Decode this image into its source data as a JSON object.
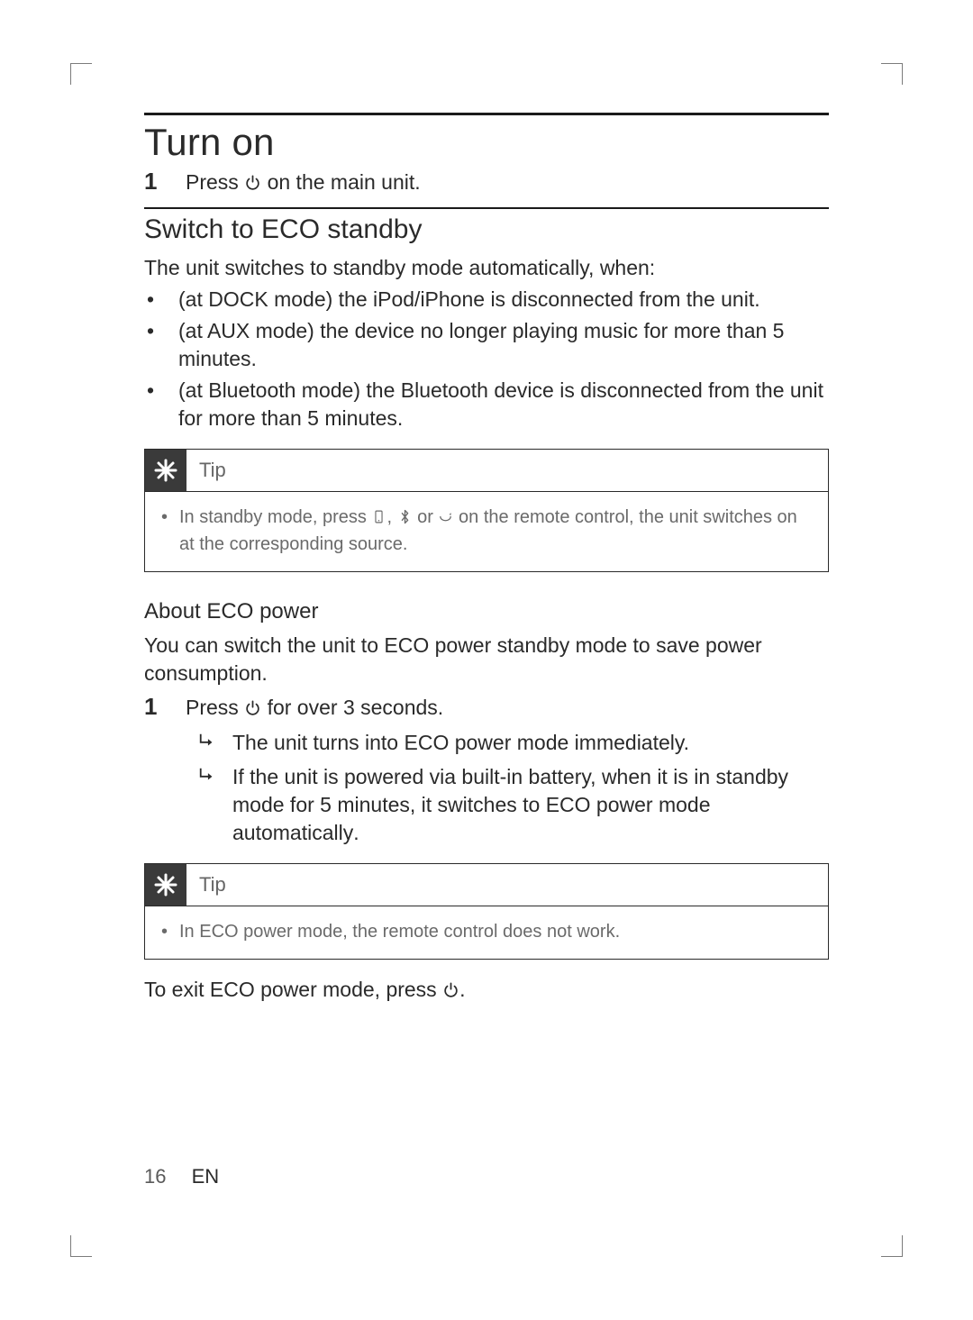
{
  "heading": "Turn on",
  "step1_num": "1",
  "step1_prefix": "Press ",
  "step1_suffix": " on the main unit.",
  "sub_heading": "Switch to ECO standby",
  "intro": "The unit switches to standby mode automatically, when:",
  "bullets": {
    "b1": "(at DOCK mode) the iPod/iPhone is disconnected from the unit.",
    "b2": "(at AUX mode) the device no longer playing music for more than 5 minutes.",
    "b3": "(at Bluetooth mode) the Bluetooth device is disconnected from the unit for more than 5 minutes."
  },
  "tip1": {
    "label": "Tip",
    "prefix": "In standby mode, press ",
    "mid1": ", ",
    "mid2": " or ",
    "suffix": " on the remote control, the unit switches on at the corresponding source."
  },
  "about_heading": "About ECO power",
  "about_text": "You can switch the unit to ECO power standby mode to save power consumption.",
  "step2_num": "1",
  "step2_prefix": "Press ",
  "step2_suffix": " for over 3 seconds.",
  "arrows": {
    "a1": "The unit turns into ECO power mode immediately.",
    "a2_prefix": "If the unit is powered via built-in battery, when it is in standby mode for 5 minutes, it switches to ECO power mode ",
    "a2_bold": "automatically",
    "a2_suffix": "."
  },
  "tip2": {
    "label": "Tip",
    "text": "In ECO power mode, the remote control does not work."
  },
  "exit_prefix": "To exit ECO power mode, press ",
  "exit_suffix": ".",
  "footer": {
    "page": "16",
    "lang": "EN"
  }
}
